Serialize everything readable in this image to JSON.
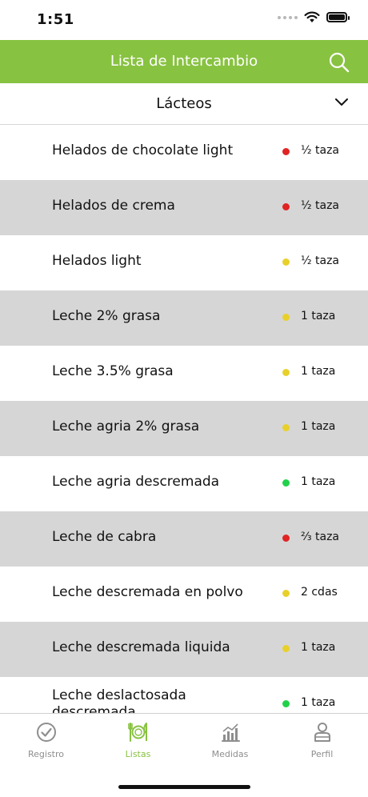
{
  "status_bar": {
    "time": "1:51"
  },
  "header": {
    "title": "Lista de Intercambio",
    "search_icon": "search-icon"
  },
  "category": {
    "selected": "Lácteos"
  },
  "colors": {
    "accent": "#88c241",
    "red": "#e02424",
    "yellow": "#e8d02a",
    "green": "#22d14a"
  },
  "items": [
    {
      "name": "Helados de chocolate light",
      "portion": "½ taza",
      "status": "red"
    },
    {
      "name": "Helados de crema",
      "portion": "½ taza",
      "status": "red"
    },
    {
      "name": "Helados light",
      "portion": "½ taza",
      "status": "yellow"
    },
    {
      "name": "Leche 2% grasa",
      "portion": "1 taza",
      "status": "yellow"
    },
    {
      "name": "Leche 3.5% grasa",
      "portion": "1 taza",
      "status": "yellow"
    },
    {
      "name": "Leche agria 2% grasa",
      "portion": "1 taza",
      "status": "yellow"
    },
    {
      "name": "Leche agria descremada",
      "portion": "1 taza",
      "status": "green"
    },
    {
      "name": "Leche de cabra",
      "portion": "⅔ taza",
      "status": "red"
    },
    {
      "name": "Leche descremada en polvo",
      "portion": "2 cdas",
      "status": "yellow"
    },
    {
      "name": "Leche descremada liquida",
      "portion": "1 taza",
      "status": "yellow"
    },
    {
      "name": "Leche deslactosada descremada",
      "portion": "1 taza",
      "status": "green"
    }
  ],
  "tabs": [
    {
      "label": "Registro",
      "icon": "check-circle-icon"
    },
    {
      "label": "Listas",
      "icon": "plate-cutlery-icon"
    },
    {
      "label": "Medidas",
      "icon": "chart-icon"
    },
    {
      "label": "Perfil",
      "icon": "person-icon"
    }
  ]
}
